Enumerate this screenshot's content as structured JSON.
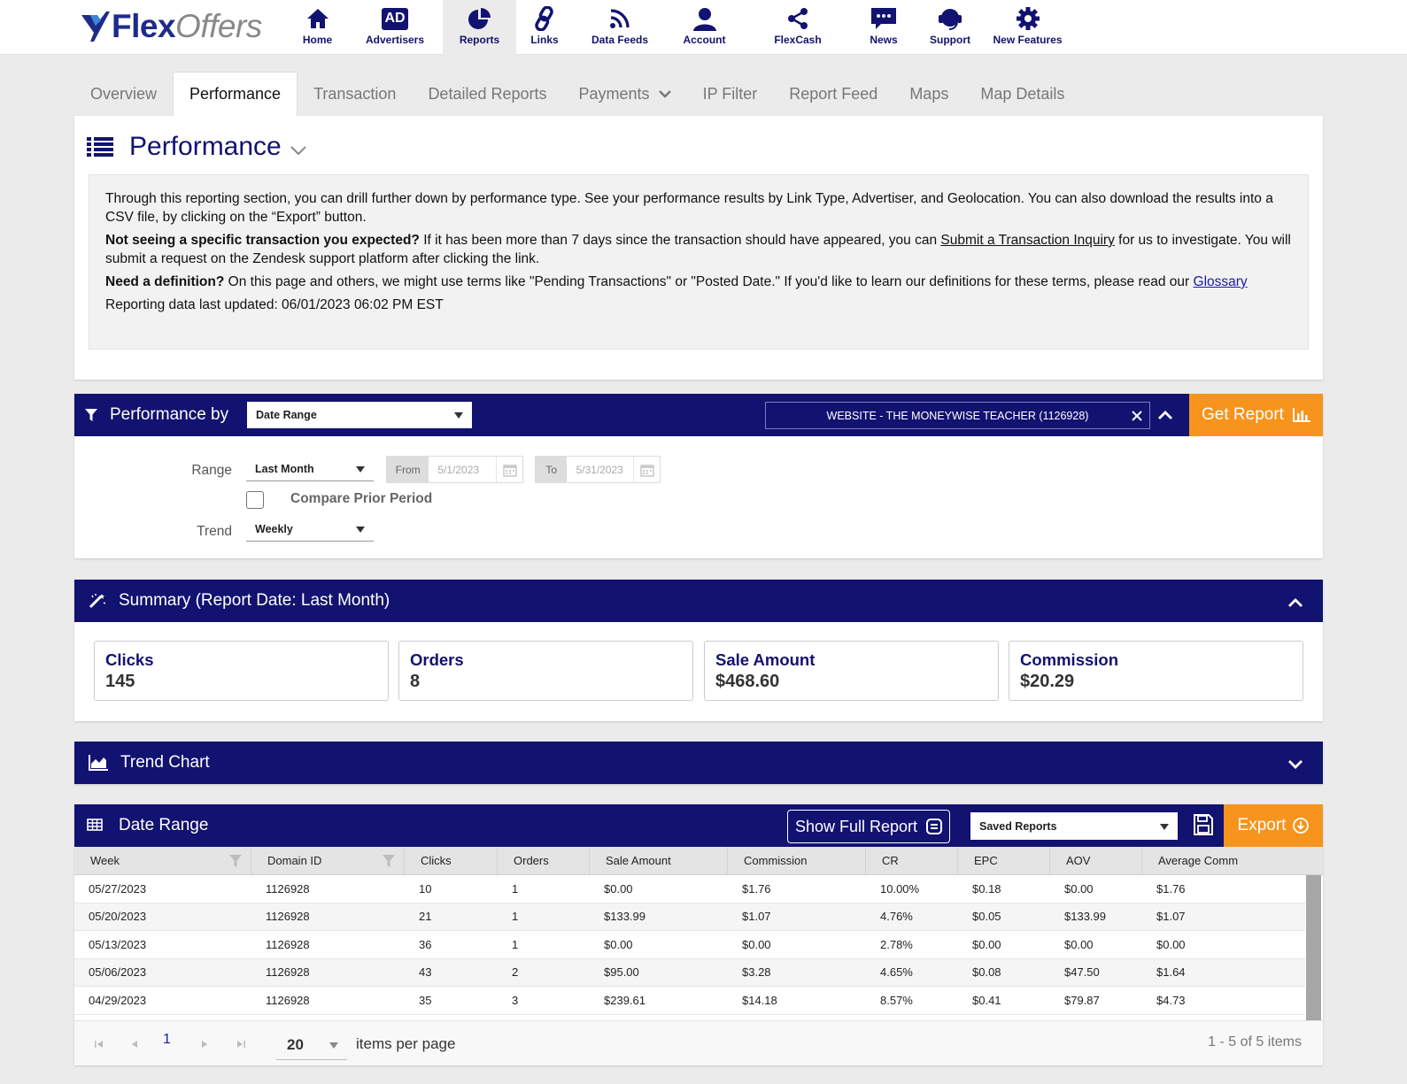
{
  "brand": {
    "name_bold": "Flex",
    "name_light": "Offers"
  },
  "nav": [
    {
      "label": "Home",
      "icon": "home-icon"
    },
    {
      "label": "Advertisers",
      "icon": "ad-icon",
      "badge": "AD"
    },
    {
      "label": "Reports",
      "icon": "pie-chart-icon",
      "active": true
    },
    {
      "label": "Links",
      "icon": "link-icon"
    },
    {
      "label": "Data Feeds",
      "icon": "rss-icon"
    },
    {
      "label": "Account",
      "icon": "user-icon"
    },
    {
      "label": "FlexCash",
      "icon": "share-icon"
    },
    {
      "label": "News",
      "icon": "chat-icon"
    },
    {
      "label": "Support",
      "icon": "headset-icon"
    },
    {
      "label": "New Features",
      "icon": "gear-icon"
    }
  ],
  "subtabs": [
    "Overview",
    "Performance",
    "Transaction",
    "Detailed Reports",
    "Payments",
    "IP Filter",
    "Report Feed",
    "Maps",
    "Map Details"
  ],
  "intro": {
    "title": "Performance",
    "p1": "Through this reporting section, you can drill further down by performance type. See your performance results by Link Type, Advertiser, and Geolocation. You can also download the results into a CSV file, by clicking on the “Export” button.",
    "p2_bold": "Not seeing a specific transaction you expected?",
    "p2_text": " If it has been more than 7 days since the transaction should have appeared, you can ",
    "p2_link": "Submit a Transaction Inquiry",
    "p2_tail": " for us to investigate. You will submit a request on the Zendesk support platform after clicking the link.",
    "p3_bold": "Need a definition?",
    "p3_text": " On this page and others, we might use terms like \"Pending Transactions\" or \"Posted Date.\" If you'd like to learn our definitions for these terms, please read our ",
    "p3_link": "Glossary",
    "p4": "Reporting data last updated: 06/01/2023 06:02 PM EST"
  },
  "perf": {
    "title": "Performance by",
    "by_value": "Date Range",
    "website": "WEBSITE - THE MONEYWISE TEACHER (1126928)",
    "get_report": "Get Report",
    "range_label": "Range",
    "range_value": "Last Month",
    "from_label": "From",
    "from_value": "5/1/2023",
    "to_label": "To",
    "to_value": "5/31/2023",
    "compare_label": "Compare Prior Period",
    "trend_label": "Trend",
    "trend_value": "Weekly"
  },
  "summary": {
    "title": "Summary  (Report Date: Last Month)",
    "cards": [
      {
        "label": "Clicks",
        "value": "145"
      },
      {
        "label": "Orders",
        "value": "8"
      },
      {
        "label": "Sale Amount",
        "value": "$468.60"
      },
      {
        "label": "Commission",
        "value": "$20.29"
      }
    ]
  },
  "trend": {
    "title": "Trend Chart"
  },
  "table": {
    "title": "Date Range",
    "show_full": "Show Full Report",
    "saved_reports": "Saved Reports",
    "export": "Export",
    "columns": [
      "Week",
      "Domain ID",
      "Clicks",
      "Orders",
      "Sale Amount",
      "Commission",
      "CR",
      "EPC",
      "AOV",
      "Average Comm"
    ],
    "rows": [
      [
        "05/27/2023",
        "1126928",
        "10",
        "1",
        "$0.00",
        "$1.76",
        "10.00%",
        "$0.18",
        "$0.00",
        "$1.76"
      ],
      [
        "05/20/2023",
        "1126928",
        "21",
        "1",
        "$133.99",
        "$1.07",
        "4.76%",
        "$0.05",
        "$133.99",
        "$1.07"
      ],
      [
        "05/13/2023",
        "1126928",
        "36",
        "1",
        "$0.00",
        "$0.00",
        "2.78%",
        "$0.00",
        "$0.00",
        "$0.00"
      ],
      [
        "05/06/2023",
        "1126928",
        "43",
        "2",
        "$95.00",
        "$3.28",
        "4.65%",
        "$0.08",
        "$47.50",
        "$1.64"
      ],
      [
        "04/29/2023",
        "1126928",
        "35",
        "3",
        "$239.61",
        "$14.18",
        "8.57%",
        "$0.41",
        "$79.87",
        "$4.73"
      ]
    ],
    "page": "1",
    "per_page": "20",
    "per_page_label": "items per page",
    "info": "1 - 5 of 5 items"
  }
}
